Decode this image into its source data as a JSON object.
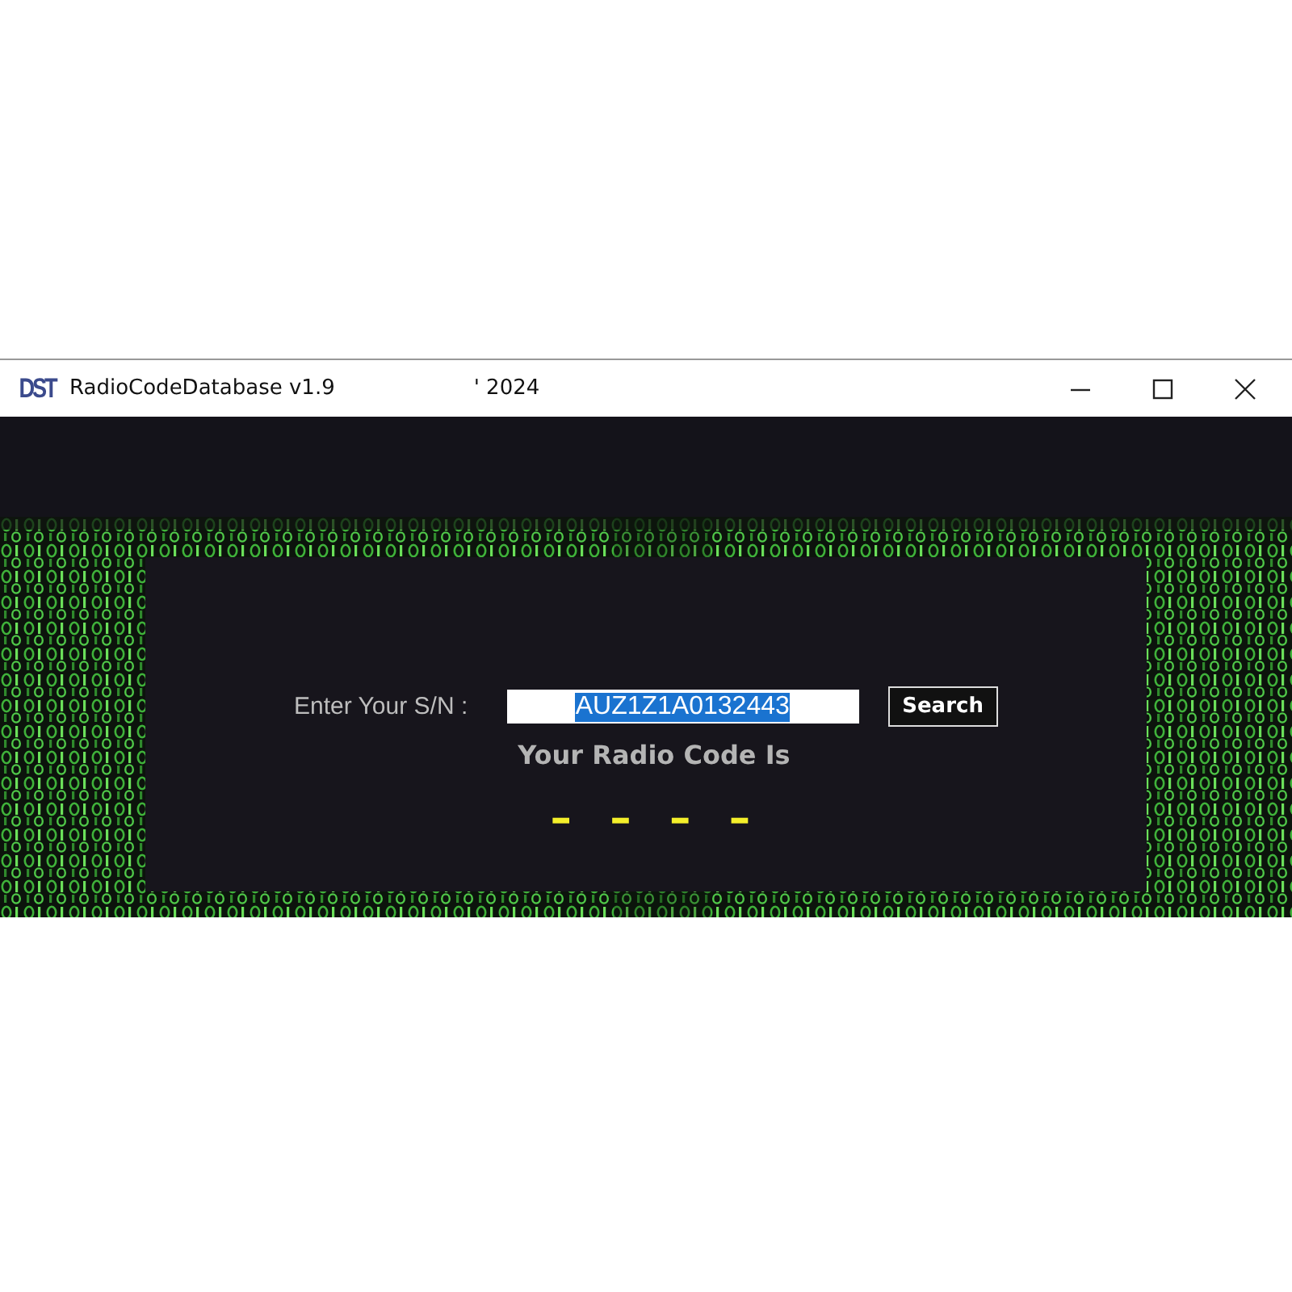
{
  "window": {
    "logo": "DST",
    "title": "RadioCodeDatabase v1.9",
    "title_suffix": "' 2024"
  },
  "form": {
    "label": "Enter Your S/N :",
    "value": "AUZ1Z1A0132443",
    "value_selected": true,
    "button": "Search"
  },
  "result": {
    "heading": "Your Radio Code Is",
    "code": "- - - -"
  }
}
